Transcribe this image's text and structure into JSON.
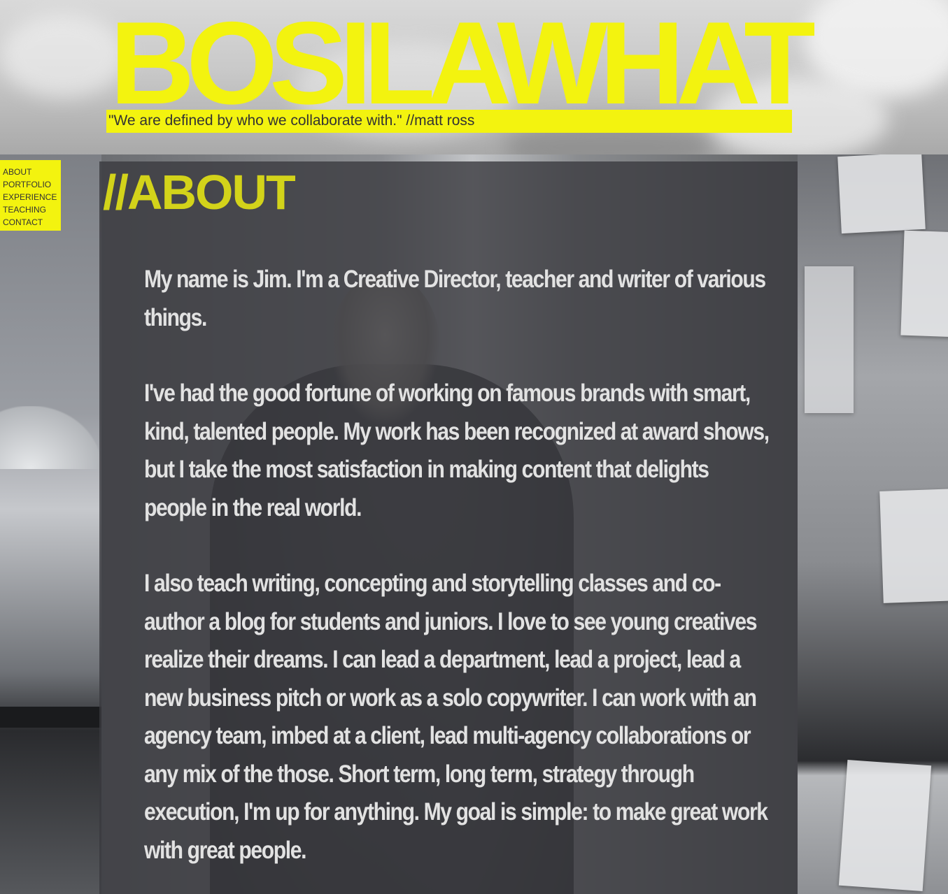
{
  "header": {
    "site_title": "BOSILAWHAT",
    "tagline": "\"We are defined by who we collaborate with.\" //matt ross"
  },
  "nav": {
    "items": [
      {
        "label": "ABOUT"
      },
      {
        "label": "PORTFOLIO"
      },
      {
        "label": "EXPERIENCE"
      },
      {
        "label": "TEACHING"
      },
      {
        "label": "CONTACT"
      }
    ]
  },
  "about": {
    "heading": "//ABOUT",
    "paragraphs": [
      "My name is Jim. I'm a Creative Director, teacher and writer of various things.",
      "I've had the good fortune of working on famous brands with smart, kind, talented people. My work has been recognized at award shows, but I take the most satisfaction in making content that delights people in the real world.",
      "I also teach writing, concepting and storytelling classes and co-author a blog for students and juniors. I love to see young creatives realize their dreams. I can lead a department, lead a project, lead a new business pitch or work as a solo copywriter. I can work with an agency team, imbed at a client, lead multi-agency collaborations or any mix of the those. Short term, long term, strategy through execution, I'm up for anything. My goal is simple: to make great work with great people."
    ]
  },
  "colors": {
    "accent_yellow": "#f3f30f",
    "heading_yellow": "#d3d31a",
    "panel": "#3a3a3e",
    "body_text": "#e2e2e2"
  }
}
